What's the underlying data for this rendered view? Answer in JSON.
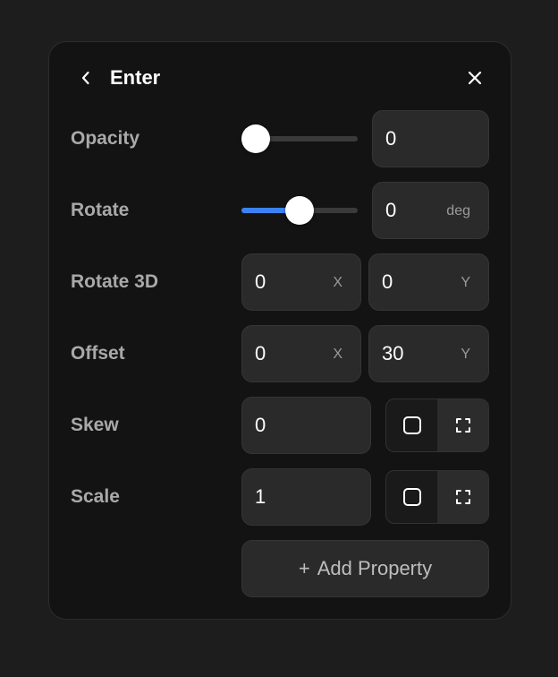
{
  "header": {
    "title": "Enter",
    "back_icon": "chevron-left-icon",
    "close_icon": "close-icon"
  },
  "properties": {
    "opacity": {
      "label": "Opacity",
      "value": "0",
      "slider_level": 0
    },
    "rotate": {
      "label": "Rotate",
      "value": "0",
      "unit": "deg",
      "slider_level": 0.5
    },
    "rotate3d": {
      "label": "Rotate 3D",
      "x": "0",
      "x_unit": "X",
      "y": "0",
      "y_unit": "Y"
    },
    "offset": {
      "label": "Offset",
      "x": "0",
      "x_unit": "X",
      "y": "30",
      "y_unit": "Y"
    },
    "skew": {
      "label": "Skew",
      "value": "0",
      "mode_icons": [
        "square-icon",
        "expand-corners-icon"
      ]
    },
    "scale": {
      "label": "Scale",
      "value": "1",
      "mode_icons": [
        "square-icon",
        "expand-corners-icon"
      ]
    }
  },
  "add_property": {
    "plus": "+",
    "label": "Add Property"
  },
  "colors": {
    "panel_bg": "#131313",
    "field_bg": "#2a2a2a",
    "accent": "#3b82f6",
    "label": "#a9a9a9"
  }
}
